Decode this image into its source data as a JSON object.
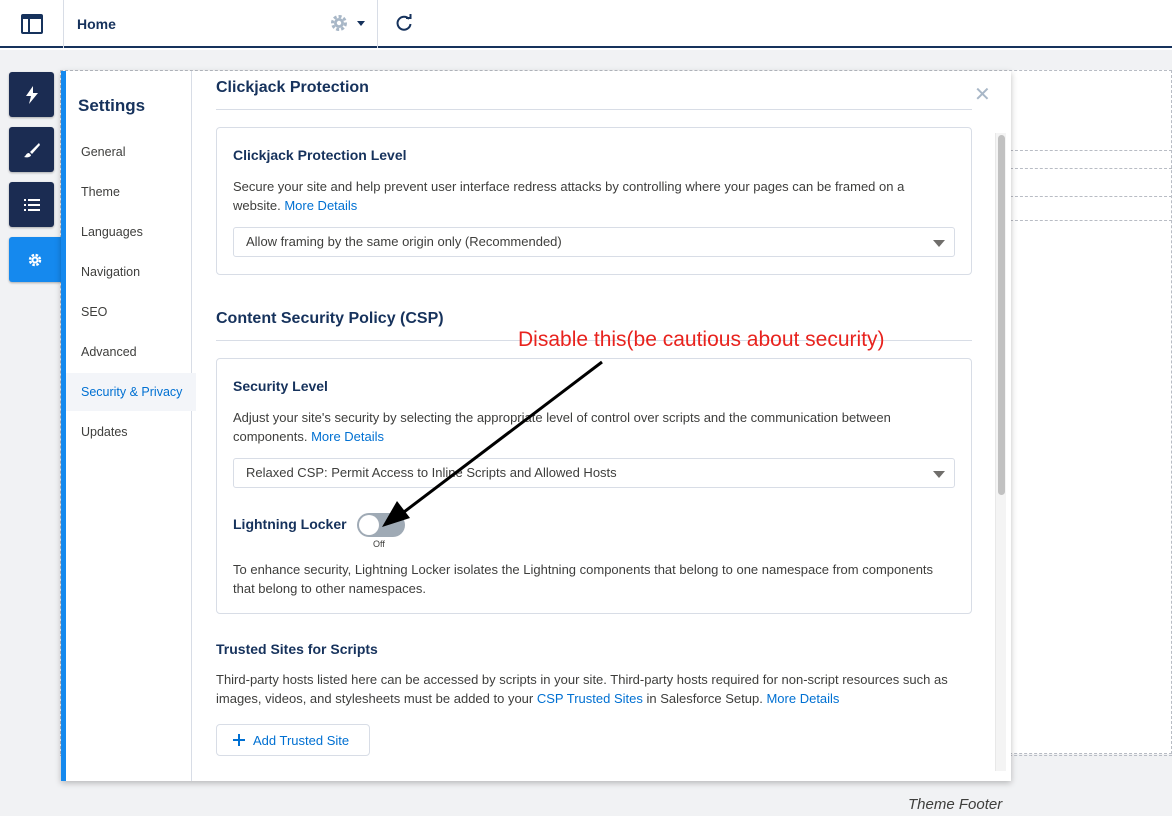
{
  "topbar": {
    "page_label": "Home"
  },
  "sidebar_rail": {
    "items": [
      "lightning-icon",
      "brush-icon",
      "list-icon",
      "gear-icon"
    ]
  },
  "settings": {
    "title": "Settings",
    "nav": [
      {
        "label": "General"
      },
      {
        "label": "Theme"
      },
      {
        "label": "Languages"
      },
      {
        "label": "Navigation"
      },
      {
        "label": "SEO"
      },
      {
        "label": "Advanced"
      },
      {
        "label": "Security & Privacy",
        "active": true
      },
      {
        "label": "Updates"
      }
    ],
    "clickjack": {
      "section_title": "Clickjack Protection",
      "card_title": "Clickjack Protection Level",
      "description": "Secure your site and help prevent user interface redress attacks by controlling where your pages can be framed on a website.",
      "link": "More Details",
      "selected": "Allow framing by the same origin only (Recommended)"
    },
    "csp": {
      "section_title": "Content Security Policy (CSP)",
      "card_title": "Security Level",
      "description": "Adjust your site's security by selecting the appropriate level of control over scripts and the communication between components.",
      "link": "More Details",
      "selected": "Relaxed CSP: Permit Access to Inline Scripts and Allowed Hosts",
      "locker_label": "Lightning Locker",
      "locker_state": "Off",
      "locker_description": "To enhance security, Lightning Locker isolates the Lightning components that belong to one namespace from components that belong to other namespaces."
    },
    "trusted_sites": {
      "title": "Trusted Sites for Scripts",
      "description_1": "Third-party hosts listed here can be accessed by scripts in your site. Third-party hosts required for non-script resources such as images, videos, and stylesheets must be added to your",
      "link_1": "CSP Trusted Sites",
      "description_2": "in Salesforce Setup.",
      "link_2": "More Details",
      "add_button": "Add Trusted Site"
    }
  },
  "footer": {
    "label": "Theme Footer"
  },
  "annotation": {
    "text": "Disable this(be cautious about security)",
    "color": "#e8231e"
  }
}
